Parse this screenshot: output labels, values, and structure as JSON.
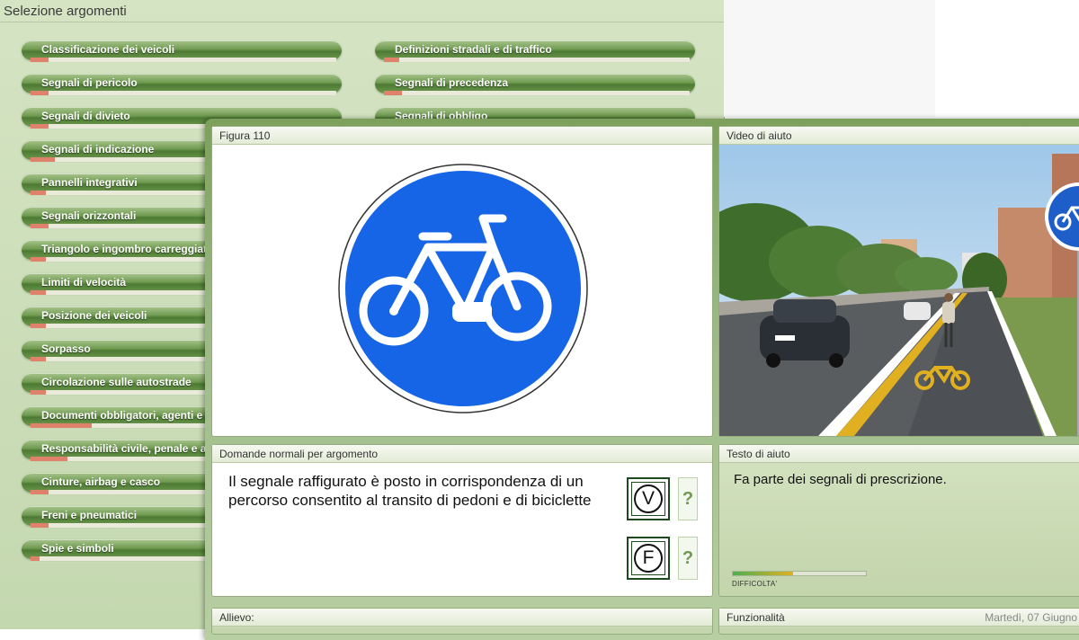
{
  "background": {
    "title": "Selezione argomenti",
    "topics_left": [
      {
        "label": "Classificazione dei veicoli",
        "progress": 0.06
      },
      {
        "label": "Segnali di pericolo",
        "progress": 0.06
      },
      {
        "label": "Segnali di divieto",
        "progress": 0.06
      },
      {
        "label": "Segnali di indicazione",
        "progress": 0.08
      },
      {
        "label": "Pannelli integrativi",
        "progress": 0.05
      },
      {
        "label": "Segnali orizzontali",
        "progress": 0.06
      },
      {
        "label": "Triangolo e ingombro carreggiata",
        "progress": 0.05
      },
      {
        "label": "Limiti di velocità",
        "progress": 0.05
      },
      {
        "label": "Posizione dei veicoli",
        "progress": 0.05
      },
      {
        "label": "Sorpasso",
        "progress": 0.05
      },
      {
        "label": "Circolazione sulle autostrade",
        "progress": 0.05
      },
      {
        "label": "Documenti obbligatori, agenti e t",
        "progress": 0.2
      },
      {
        "label": "Responsabilità civile, penale e a",
        "progress": 0.12
      },
      {
        "label": "Cinture, airbag e casco",
        "progress": 0.06
      },
      {
        "label": "Freni e pneumatici",
        "progress": 0.06
      },
      {
        "label": "Spie e simboli",
        "progress": 0.03
      }
    ],
    "topics_right": [
      {
        "label": "Definizioni stradali e di traffico",
        "progress": 0.05
      },
      {
        "label": "Segnali di precedenza",
        "progress": 0.06
      },
      {
        "label": "Segnali di obbligo",
        "progress": 0.06
      }
    ]
  },
  "figure_panel": {
    "title": "Figura 110"
  },
  "video_panel": {
    "title": "Video di aiuto"
  },
  "question_panel": {
    "title": "Domande normali per argomento",
    "text": "Il segnale raffigurato è posto in corrispondenza di un percorso consentito al transito di pedoni e di biciclette",
    "true_label": "V",
    "false_label": "F",
    "help_label": "?"
  },
  "help_panel": {
    "title": "Testo di aiuto",
    "text": "Fa parte dei segnali di prescrizione.",
    "difficulty_label": "DIFFICOLTA'",
    "difficulty": 0.45
  },
  "student_panel": {
    "title": "Allievo:"
  },
  "functions_panel": {
    "title": "Funzionalità",
    "date": "Martedì, 07 Giugno"
  },
  "colors": {
    "sign_blue": "#1565e6",
    "accent_green": "#6f9a50",
    "progress_red": "#e0826b"
  }
}
